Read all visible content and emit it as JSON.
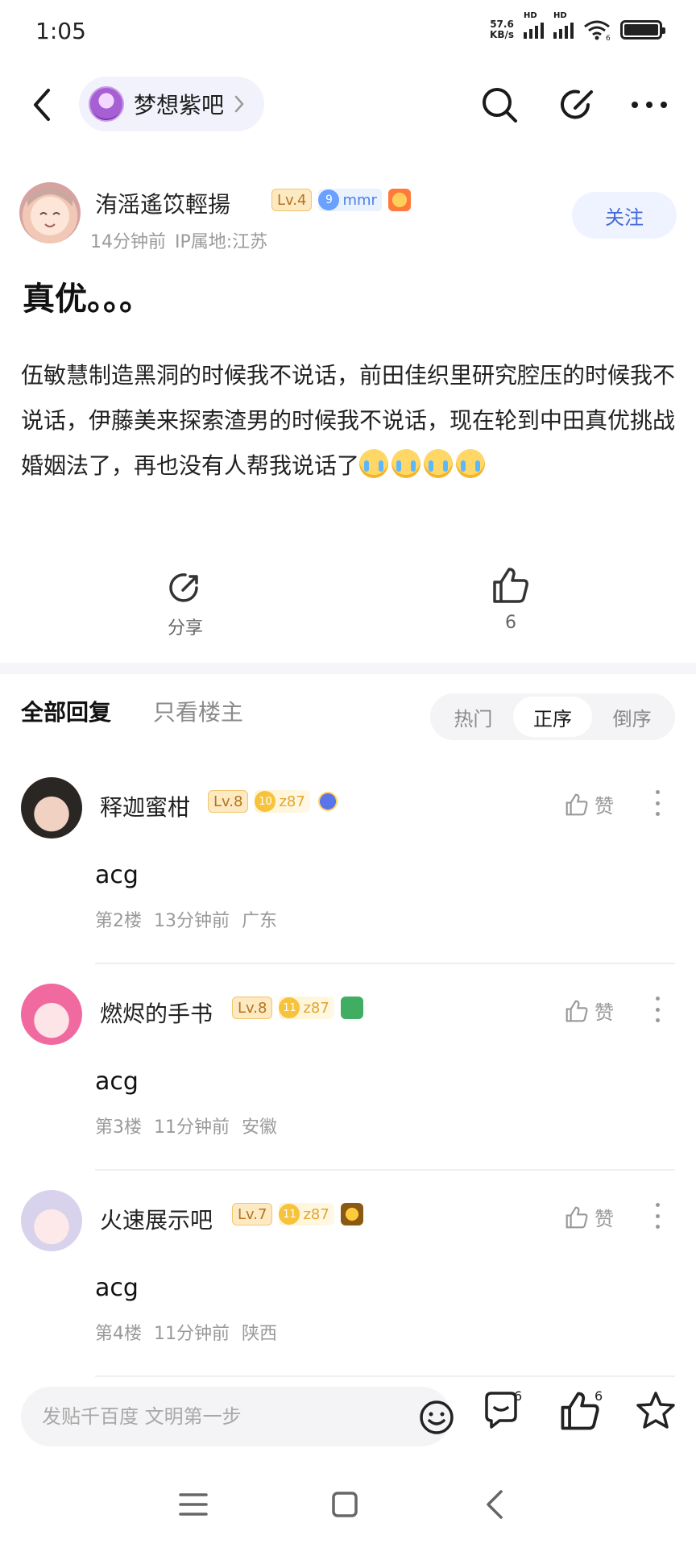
{
  "status_bar": {
    "time": "1:05",
    "net_speed_value": "57.6",
    "net_speed_unit": "KB/s",
    "sim1_label": "HD",
    "sim2_label": "HD",
    "wifi_label": "6"
  },
  "topnav": {
    "forum_name": "梦想紫吧"
  },
  "post": {
    "author_name": "洧滛遙笖輕揚",
    "author_level": "Lv.4",
    "member_level": "9",
    "member_label": "mmr",
    "time_ago": "14分钟前",
    "ip_location": "IP属地:江苏",
    "follow_label": "关注",
    "title": "真优。。。",
    "body": "伍敏慧制造黑洞的时候我不说话，前田佳织里研究腔压的时候我不说话，伊藤美来探索渣男的时候我不说话，现在轮到中田真优挑战婚姻法了，再也没有人帮我说话了",
    "share_label": "分享",
    "like_count": "6"
  },
  "reply_tabs": {
    "all_label": "全部回复",
    "owner_only_label": "只看楼主",
    "sort_options": [
      "热门",
      "正序",
      "倒序"
    ],
    "active_sort": "正序"
  },
  "comments": [
    {
      "name": "释迦蜜柑",
      "level": "Lv.8",
      "gold_level": "10",
      "gold_label": "z87",
      "text": "acg",
      "floor": "第2楼",
      "time_ago": "13分钟前",
      "location": "广东",
      "like_label": "赞"
    },
    {
      "name": "燃烬的手书",
      "level": "Lv.8",
      "gold_level": "11",
      "gold_label": "z87",
      "text": "acg",
      "floor": "第3楼",
      "time_ago": "11分钟前",
      "location": "安徽",
      "like_label": "赞"
    },
    {
      "name": "火速展示吧",
      "level": "Lv.7",
      "gold_level": "11",
      "gold_label": "z87",
      "text": "acg",
      "floor": "第4楼",
      "time_ago": "11分钟前",
      "location": "陕西",
      "like_label": "赞"
    }
  ],
  "bottom_bar": {
    "input_placeholder": "发贴千百度 文明第一步",
    "comment_count": "6",
    "like_count": "6"
  },
  "colors": {
    "accent_blue": "#4468d8",
    "level_gold": "#b4741e",
    "muted_text": "#9a9a9a"
  }
}
